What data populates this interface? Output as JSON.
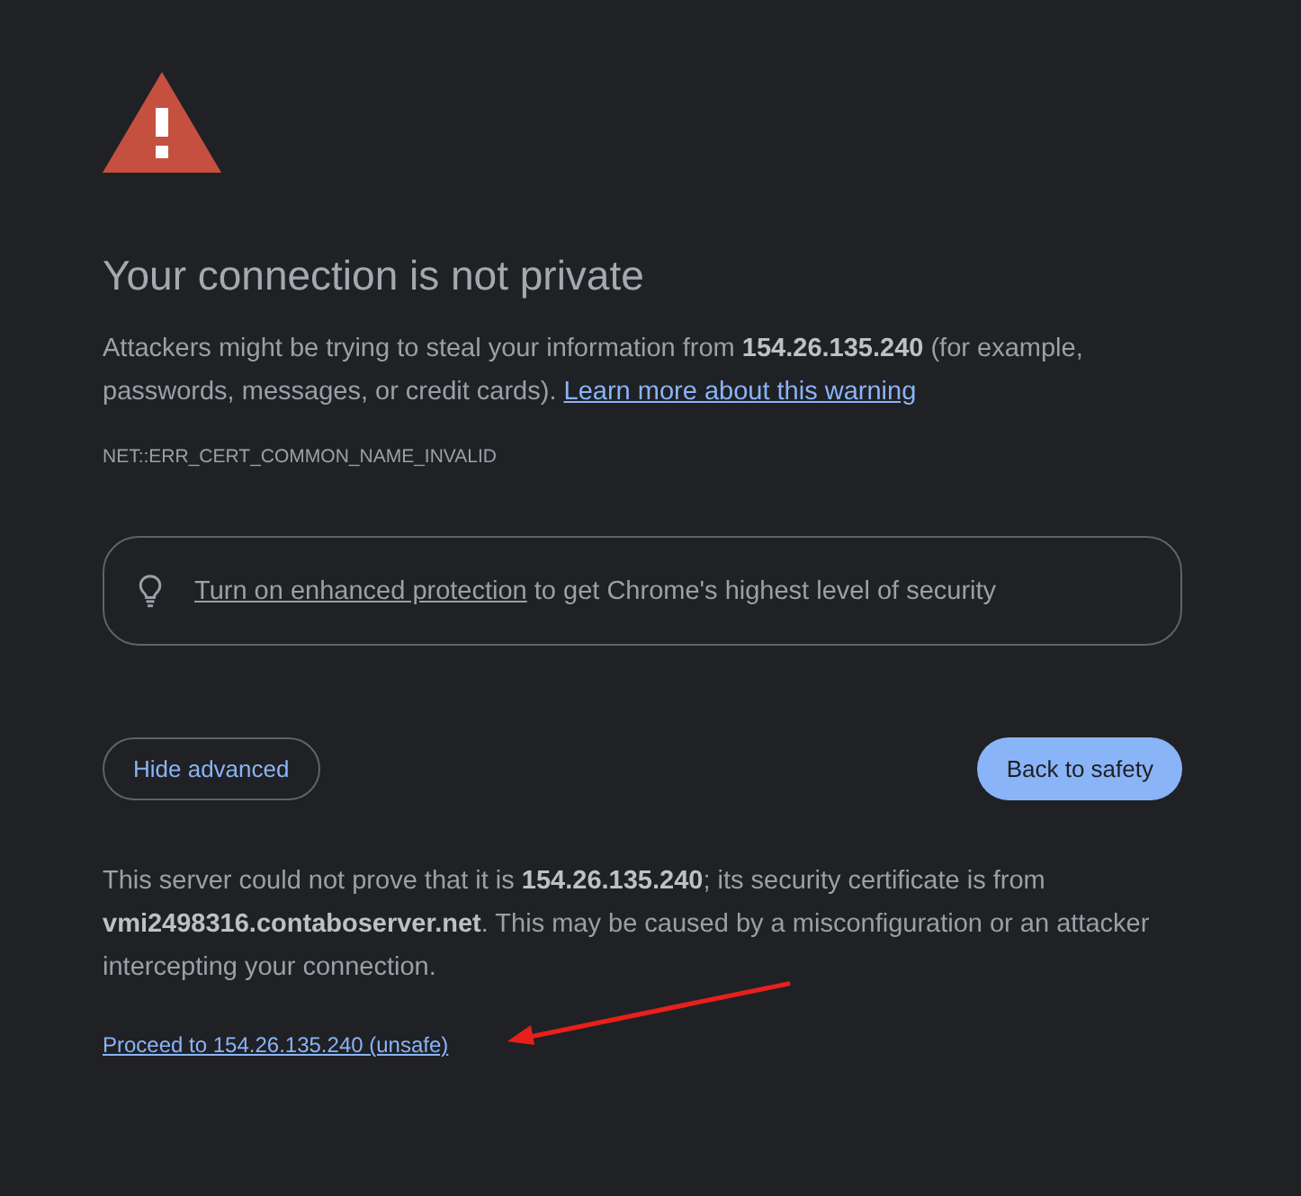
{
  "heading": "Your connection is not private",
  "intro": {
    "text": "Attackers might be trying to steal your information from **154.26.135.240** (for example, passwords, messages, or credit cards).",
    "link": "Learn more about this warning"
  },
  "error_code": "NET::ERR_CERT_COMMON_NAME_INVALID",
  "enhanced_protection": {
    "link": "Turn on enhanced protection",
    "text": "to get Chrome's highest level of security"
  },
  "buttons": [
    {
      "label": "Hide advanced",
      "kind": "secondary"
    },
    {
      "label": "Back to safety",
      "kind": "primary"
    }
  ],
  "details": "This server could not prove that it is **154.26.135.240**; its security certificate is from **vmi2498316.contaboserver.net**. This may be caused by a misconfiguration or an attacker intercepting your connection.",
  "proceed_link": "Proceed to 154.26.135.240 (unsafe)",
  "annotations": [
    {
      "kind": "arrow"
    }
  ]
}
